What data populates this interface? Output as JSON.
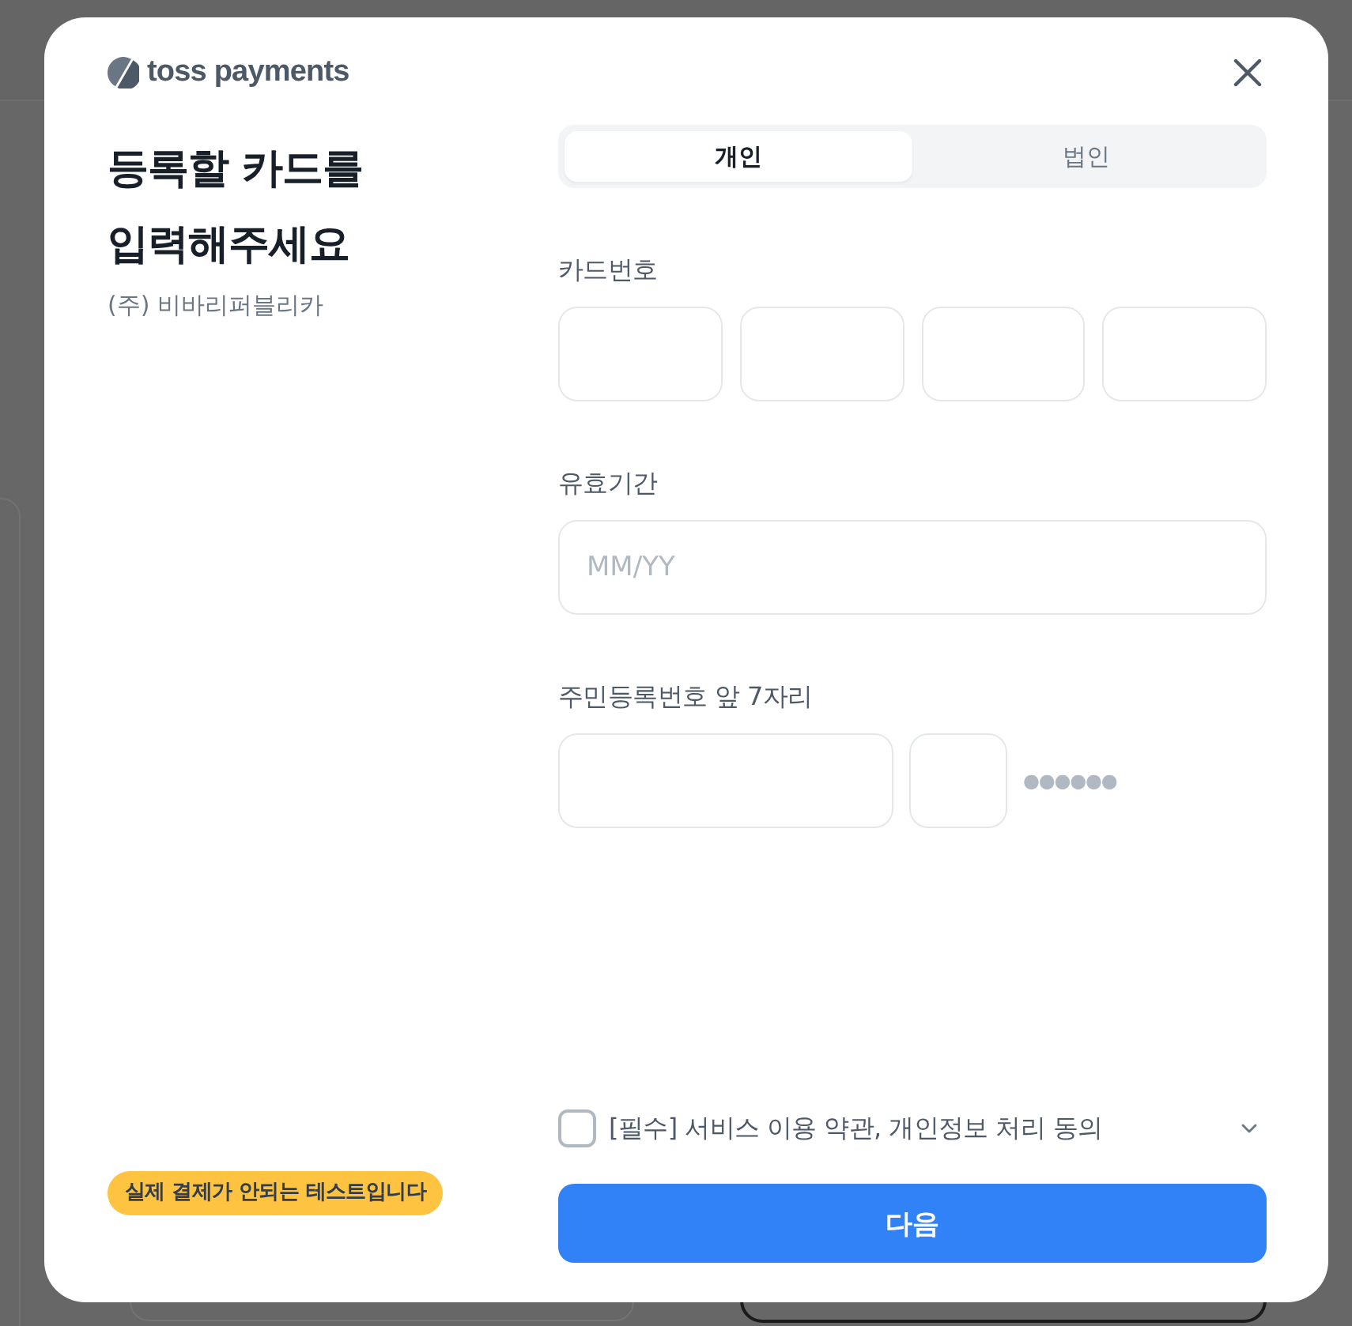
{
  "logo": {
    "text": "toss payments"
  },
  "heading": {
    "title": "등록할 카드를 입력해주세요",
    "merchant": "(주) 비바리퍼블리카"
  },
  "test_badge": {
    "text": "실제 결제가 안되는 테스트입니다"
  },
  "tabs": [
    {
      "label": "개인",
      "selected": true
    },
    {
      "label": "법인",
      "selected": false
    }
  ],
  "card_number": {
    "label": "카드번호",
    "fields": [
      {
        "kind": "digits"
      },
      {
        "kind": "digits"
      },
      {
        "kind": "digits"
      },
      {
        "kind": "digits"
      }
    ]
  },
  "expiry": {
    "label": "유효기간",
    "placeholder": "MM/YY"
  },
  "resident_number": {
    "label": "주민등록번호 앞 7자리",
    "fields": [
      {
        "kind": "birthdate"
      },
      {
        "kind": "gender"
      }
    ],
    "mask": "●●●●●●"
  },
  "agreement": {
    "checked": false,
    "label": "[필수] 서비스 이용 약관, 개인정보 처리 동의",
    "expanded": false
  },
  "submit_button": {
    "label": "다음"
  }
}
